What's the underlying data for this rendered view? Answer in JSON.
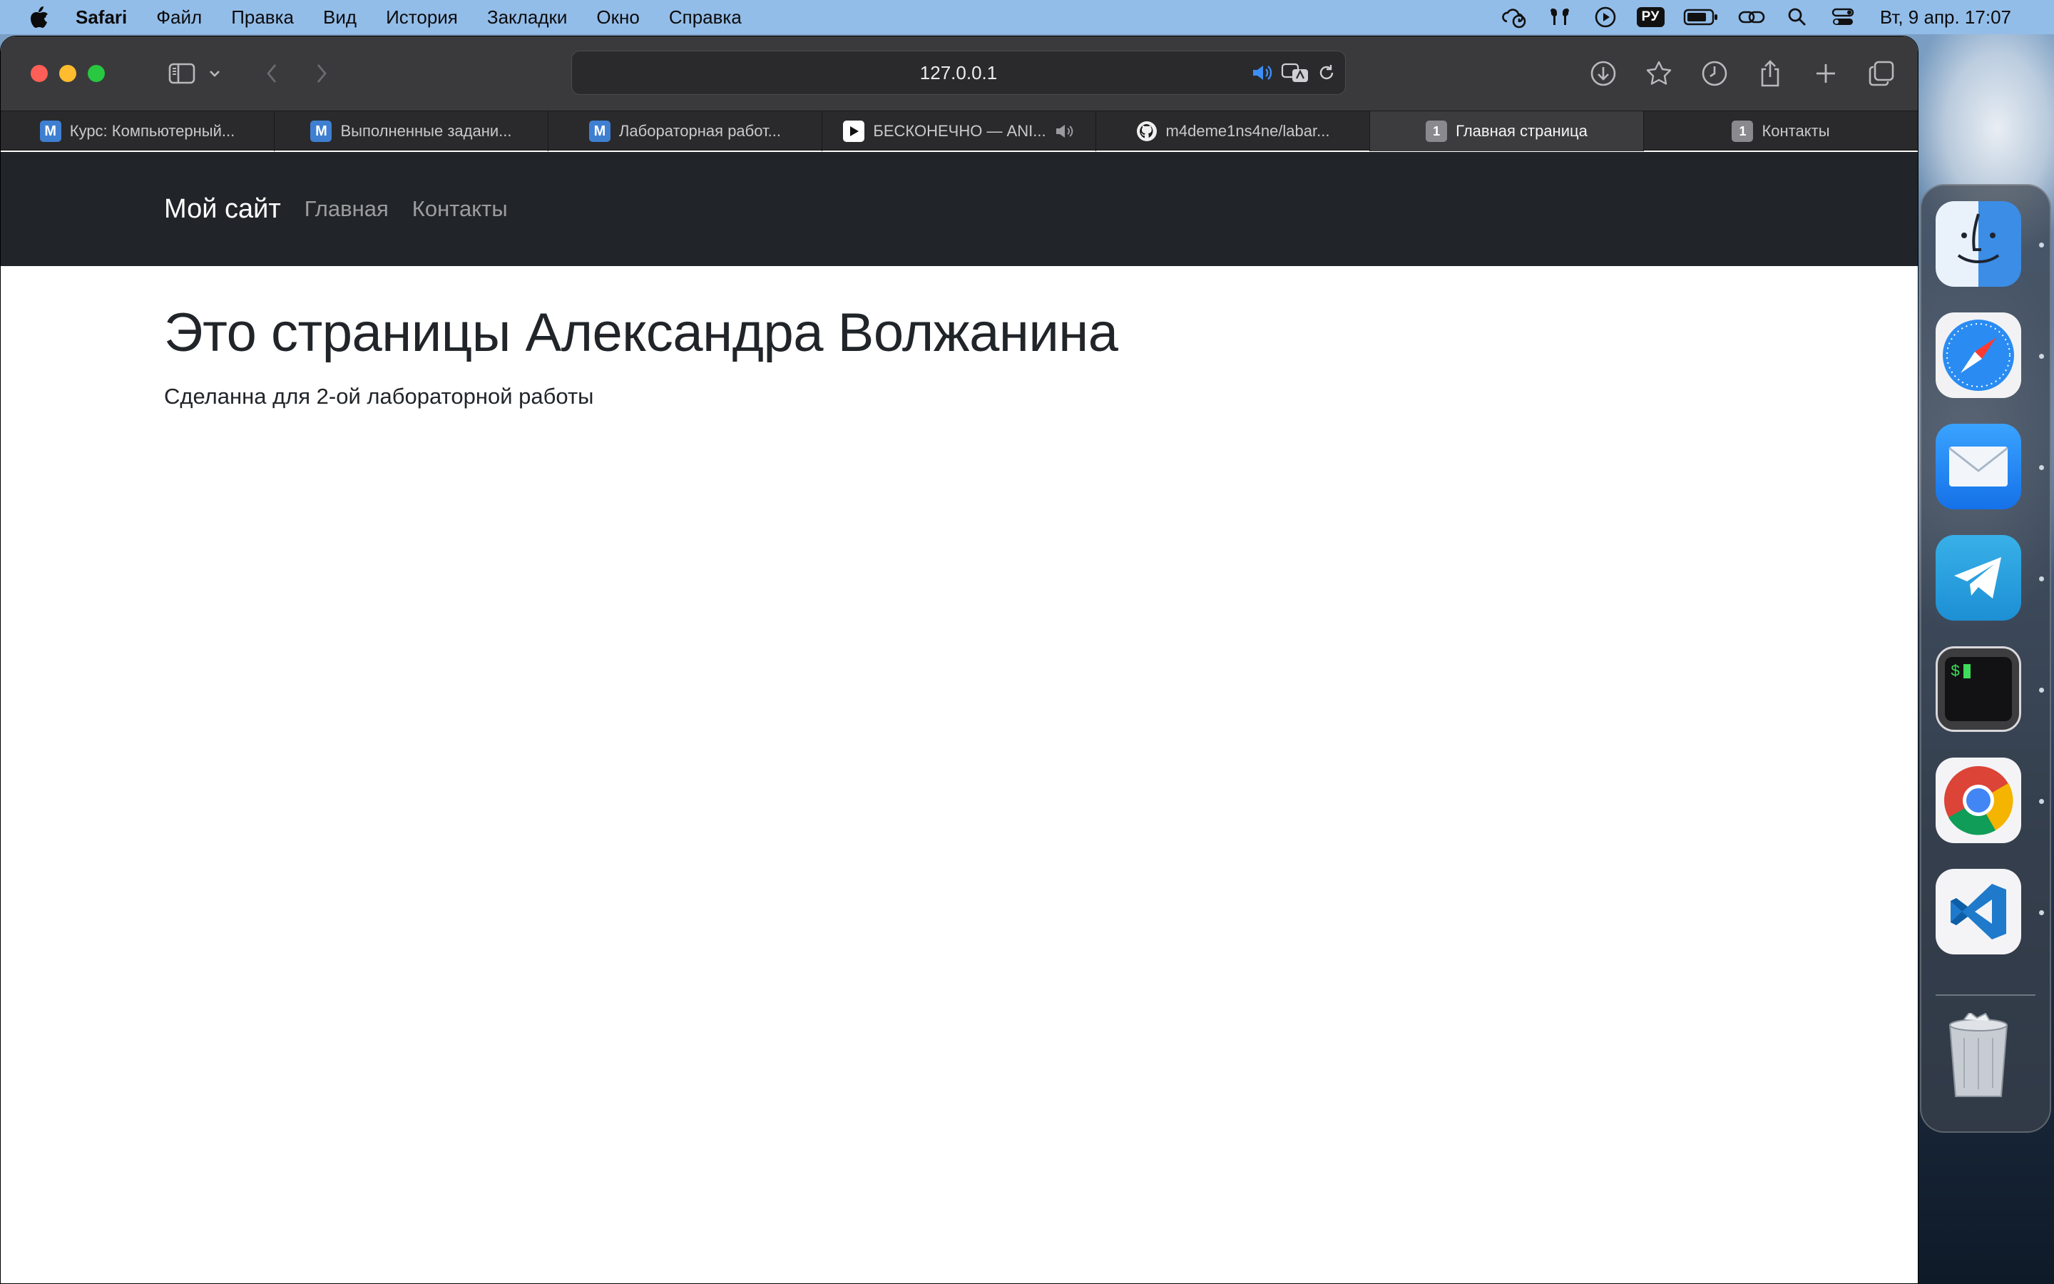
{
  "menubar": {
    "app_name": "Safari",
    "items": [
      "Файл",
      "Правка",
      "Вид",
      "История",
      "Закладки",
      "Окно",
      "Справка"
    ],
    "input_source": "РУ",
    "clock": "Вт, 9 апр.  17:07"
  },
  "browser": {
    "url": "127.0.0.1",
    "tabs": [
      {
        "label": "Курс: Компьютерный...",
        "favicon": "М",
        "favicon_type": "moodle"
      },
      {
        "label": "Выполненные задани...",
        "favicon": "М",
        "favicon_type": "moodle"
      },
      {
        "label": "Лабораторная работ...",
        "favicon": "М",
        "favicon_type": "moodle"
      },
      {
        "label": "БЕСКОНЕЧНО — ANI...",
        "favicon": "play-icon",
        "favicon_type": "play",
        "playing_audio": true
      },
      {
        "label": "m4deme1ns4ne/labar...",
        "favicon": "github-icon",
        "favicon_type": "github"
      },
      {
        "label": "Главная страница",
        "favicon": "1",
        "favicon_type": "number",
        "active": true
      },
      {
        "label": "Контакты",
        "favicon": "1",
        "favicon_type": "number"
      }
    ]
  },
  "page": {
    "brand": "Мой сайт",
    "nav": [
      "Главная",
      "Контакты"
    ],
    "heading": "Это страницы Александра Волжанина",
    "subtext": "Сделанна для 2-ой лабораторной работы"
  },
  "dock": {
    "apps": [
      "finder-icon",
      "safari-icon",
      "mail-icon",
      "telegram-icon",
      "terminal-icon",
      "chrome-icon",
      "vscode-icon",
      "trash-icon"
    ]
  },
  "colors": {
    "menubar": "#93bde9",
    "navbar": "#212529",
    "toolbar": "#3a3a3c",
    "moodle_blue": "#3f7fd1"
  }
}
